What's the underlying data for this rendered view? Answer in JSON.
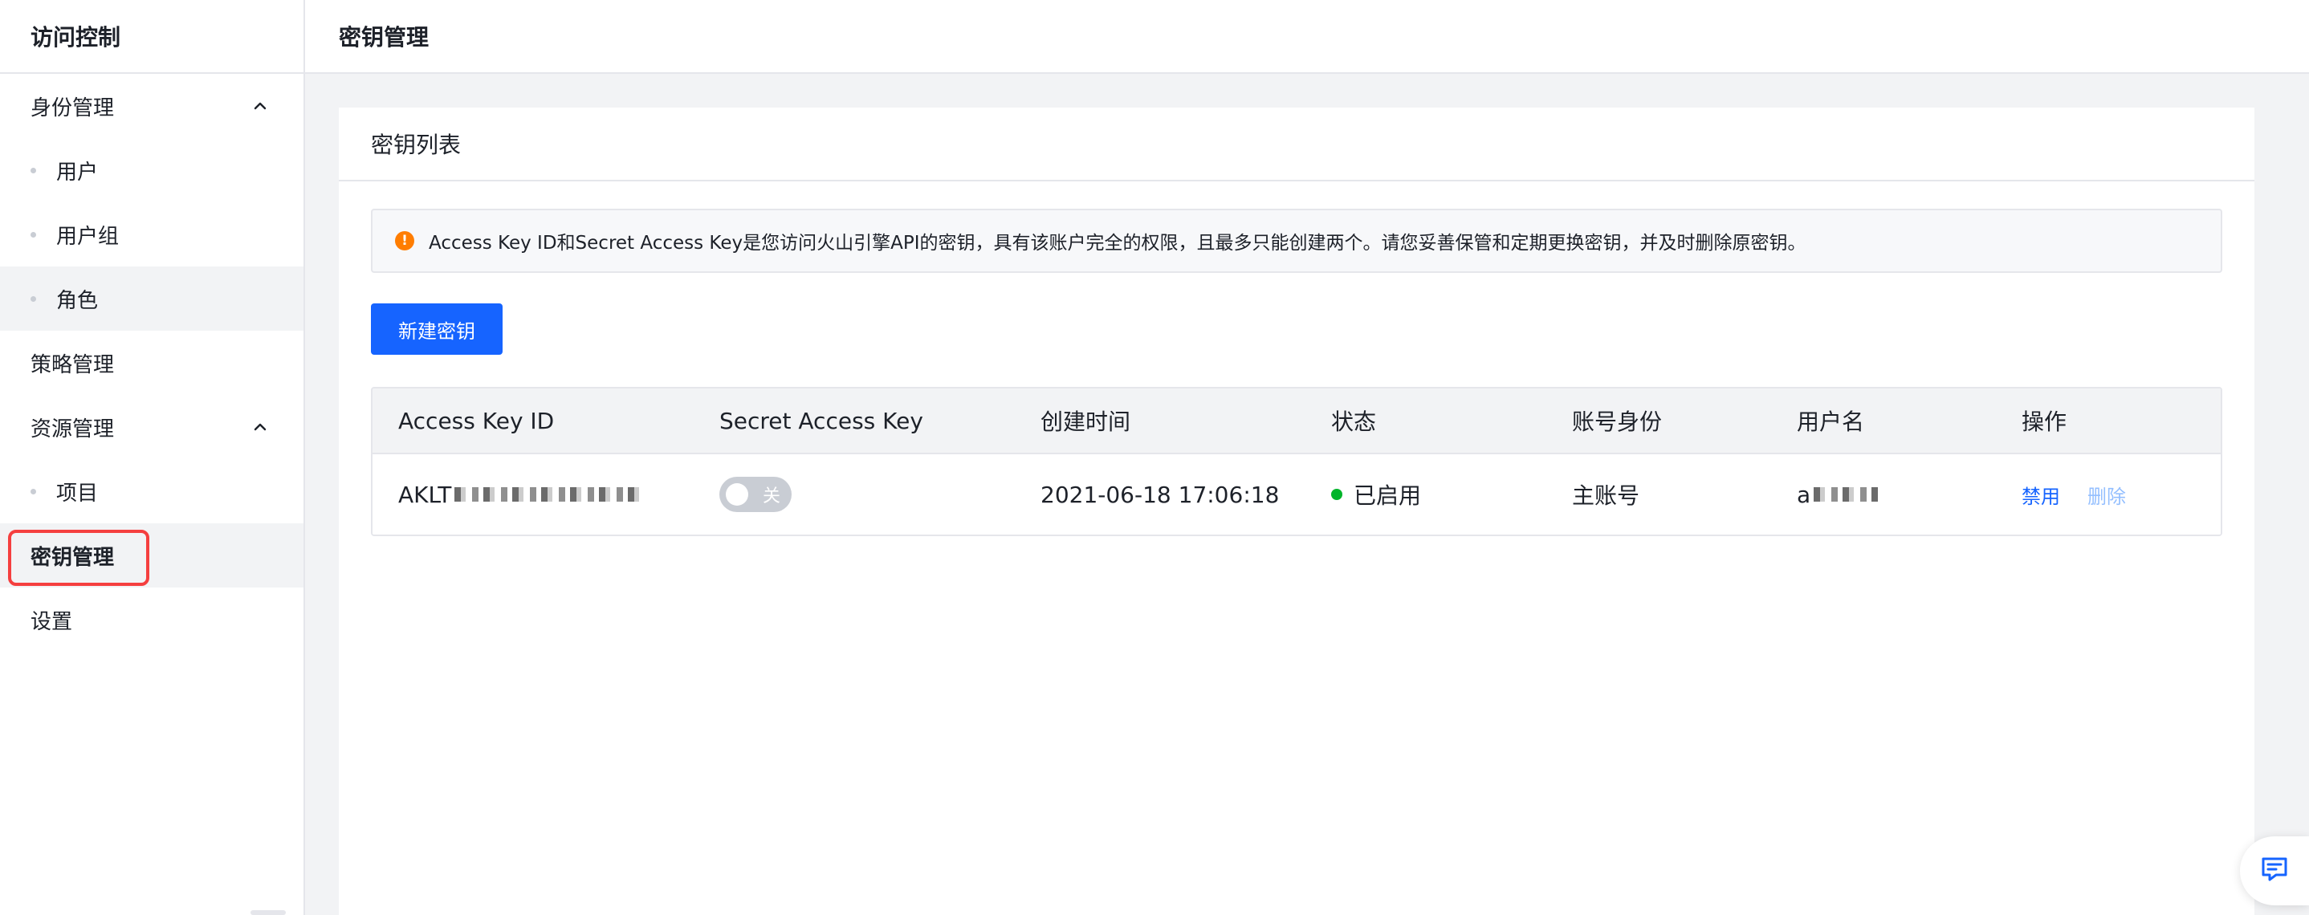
{
  "sidebar": {
    "title": "访问控制",
    "items": [
      {
        "label": "身份管理",
        "type": "group",
        "expanded": true
      },
      {
        "label": "用户",
        "type": "sub"
      },
      {
        "label": "用户组",
        "type": "sub"
      },
      {
        "label": "角色",
        "type": "sub"
      },
      {
        "label": "策略管理",
        "type": "item"
      },
      {
        "label": "资源管理",
        "type": "group",
        "expanded": true
      },
      {
        "label": "项目",
        "type": "sub"
      },
      {
        "label": "密钥管理",
        "type": "item",
        "selected": true
      },
      {
        "label": "设置",
        "type": "item"
      }
    ]
  },
  "header": {
    "title": "密钥管理"
  },
  "card": {
    "title": "密钥列表",
    "alert": "Access Key ID和Secret Access Key是您访问火山引擎API的密钥，具有该账户完全的权限，且最多只能创建两个。请您妥善保管和定期更换密钥，并及时删除原密钥。",
    "alert_icon": "!",
    "create_button": "新建密钥"
  },
  "table": {
    "columns": [
      "Access Key ID",
      "Secret Access Key",
      "创建时间",
      "状态",
      "账号身份",
      "用户名",
      "操作"
    ],
    "rows": [
      {
        "access_key_prefix": "AKLT",
        "secret_toggle_label": "关",
        "created": "2021-06-18 17:06:18",
        "status": "已启用",
        "identity": "主账号",
        "username_prefix": "a",
        "action_disable": "禁用",
        "action_delete": "删除"
      }
    ]
  },
  "colors": {
    "primary": "#1664ff",
    "warning": "#ff7d00",
    "success": "#00b42a",
    "highlight": "#f53f3f"
  }
}
